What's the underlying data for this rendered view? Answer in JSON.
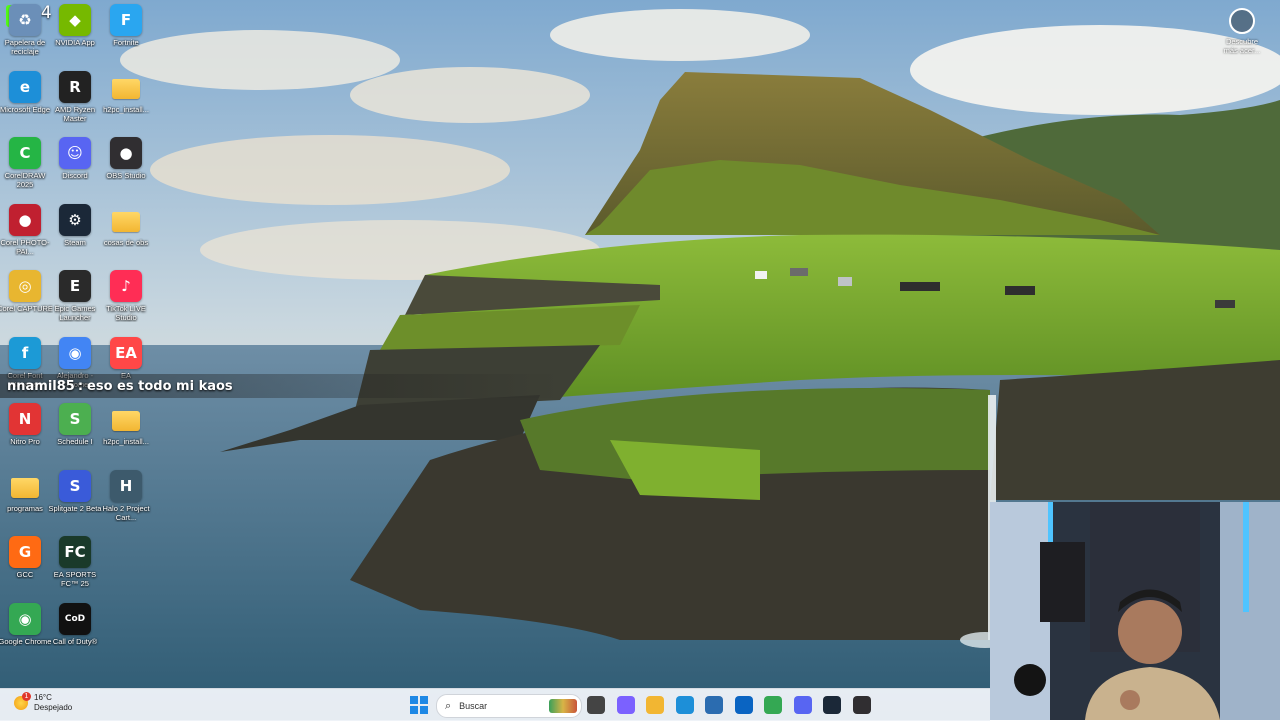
{
  "overlay": {
    "counter": "94",
    "chat_username": "nnamil85",
    "chat_separator": ":",
    "chat_message": "eso es todo mi kaos"
  },
  "discover": {
    "label": "Descubre más acer..."
  },
  "desktop_icons": {
    "col1": [
      {
        "label": "Papelera de reciclaje",
        "icon": "recycle-bin-icon",
        "color": "#6b8fb8"
      },
      {
        "label": "Microsoft Edge",
        "icon": "edge-icon",
        "color": "#1d8fd8"
      },
      {
        "label": "CorelDRAW 2025",
        "icon": "coreldraw-icon",
        "color": "#25b545"
      },
      {
        "label": "Corel PHOTO-PAI...",
        "icon": "corel-photopaint-icon",
        "color": "#c02030"
      },
      {
        "label": "Corel CAPTURE",
        "icon": "corel-capture-icon",
        "color": "#e8b630"
      },
      {
        "label": "Corel Font Manager",
        "icon": "corel-font-icon",
        "color": "#1c9ad6"
      },
      {
        "label": "Nitro Pro",
        "icon": "nitro-pro-icon",
        "color": "#e23434"
      },
      {
        "label": "programas",
        "icon": "folder-icon",
        "color": "#f2b632"
      },
      {
        "label": "GCC",
        "icon": "gcc-icon",
        "color": "#ff6a13"
      },
      {
        "label": "Google Chrome",
        "icon": "chrome-icon",
        "color": "#34a853"
      }
    ],
    "col2": [
      {
        "label": "NVIDIA App",
        "icon": "nvidia-icon",
        "color": "#76b900"
      },
      {
        "label": "AMD Ryzen Master",
        "icon": "ryzen-master-icon",
        "color": "#222222"
      },
      {
        "label": "Discord",
        "icon": "discord-icon",
        "color": "#5865f2"
      },
      {
        "label": "Steam",
        "icon": "steam-icon",
        "color": "#1b2838"
      },
      {
        "label": "Epic Games Launcher",
        "icon": "epic-games-icon",
        "color": "#2a2a2a"
      },
      {
        "label": "Alejandro - Chrome",
        "icon": "chrome-profile-icon",
        "color": "#4285f4"
      },
      {
        "label": "Schedule I",
        "icon": "schedule-one-icon",
        "color": "#4caf50"
      },
      {
        "label": "Splitgate 2 Beta",
        "icon": "splitgate-icon",
        "color": "#3a5bd9"
      },
      {
        "label": "EA SPORTS FC™ 25",
        "icon": "ea-fc25-icon",
        "color": "#1a3a2a"
      },
      {
        "label": "Call of Duty®",
        "icon": "call-of-duty-icon",
        "color": "#111111"
      }
    ],
    "col3": [
      {
        "label": "Fortnite",
        "icon": "fortnite-icon",
        "color": "#2aa6f0"
      },
      {
        "label": "h2pc_install...",
        "icon": "folder-icon",
        "color": "#f2b632"
      },
      {
        "label": "OBS Studio",
        "icon": "obs-icon",
        "color": "#302e31"
      },
      {
        "label": "cosas de obs",
        "icon": "folder-icon",
        "color": "#f2b632"
      },
      {
        "label": "TikTok LIVE Studio",
        "icon": "tiktok-live-icon",
        "color": "#ff2d55"
      },
      {
        "label": "EA",
        "icon": "ea-app-icon",
        "color": "#ff4747"
      },
      {
        "label": "h2pc_install...",
        "icon": "folder-icon",
        "color": "#f2b632"
      },
      {
        "label": "Halo 2 Project Cart...",
        "icon": "halo2-icon",
        "color": "#3d5a6c"
      }
    ]
  },
  "taskbar": {
    "weather_temp": "16°C",
    "weather_desc": "Despejado",
    "weather_alert": "1",
    "search_placeholder": "Buscar",
    "pinned": [
      {
        "name": "task-view-icon",
        "color": "#444444"
      },
      {
        "name": "copilot-icon",
        "color": "#7b61ff"
      },
      {
        "name": "file-explorer-icon",
        "color": "#f2b632"
      },
      {
        "name": "edge-icon",
        "color": "#1d8fd8"
      },
      {
        "name": "microsoft-store-icon",
        "color": "#2b6cb0"
      },
      {
        "name": "outlook-icon",
        "color": "#0a64c2"
      },
      {
        "name": "chrome-icon",
        "color": "#34a853"
      },
      {
        "name": "discord-icon",
        "color": "#5865f2"
      },
      {
        "name": "steam-icon",
        "color": "#1b2838"
      },
      {
        "name": "obs-icon",
        "color": "#302e31"
      }
    ]
  }
}
